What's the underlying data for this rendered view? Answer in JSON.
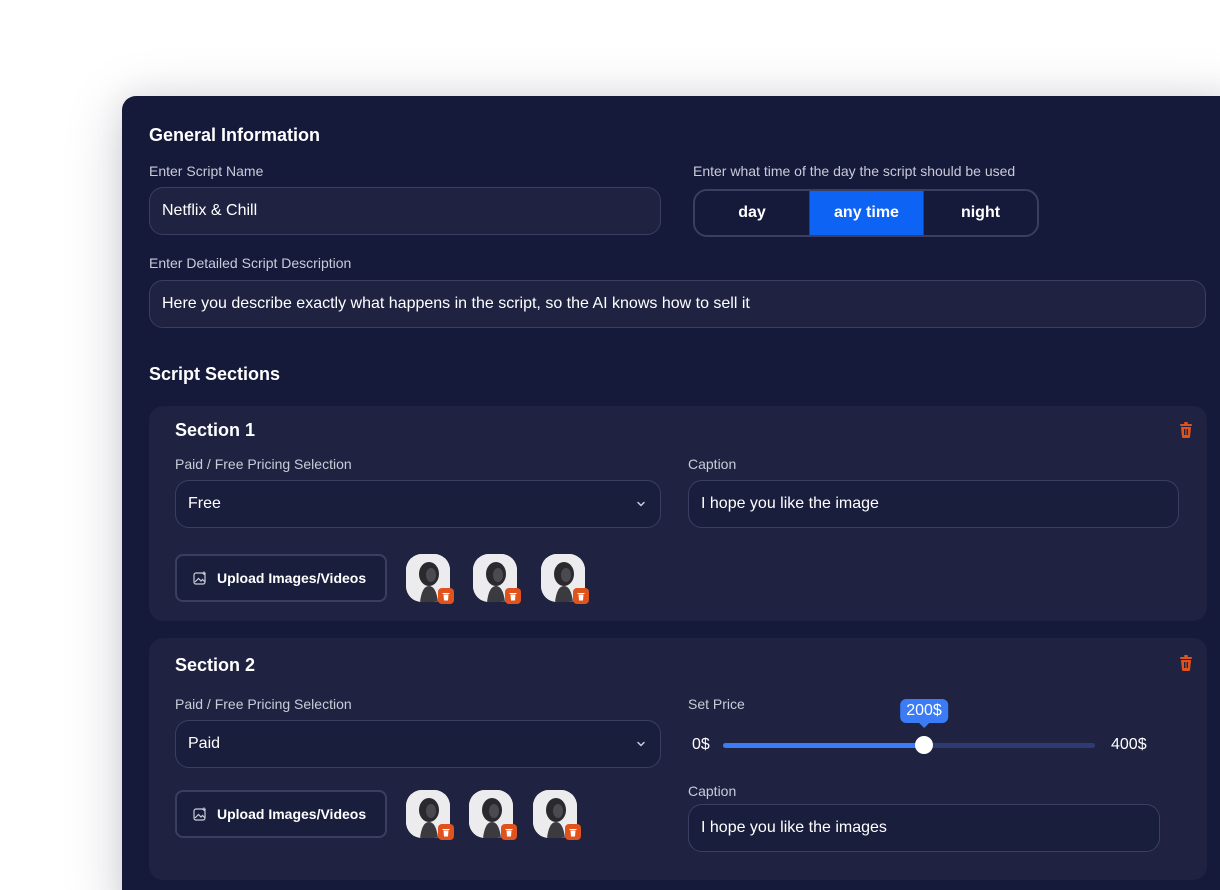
{
  "general": {
    "title": "General Information",
    "script_name_label": "Enter Script Name",
    "script_name_value": "Netflix & Chill",
    "time_label": "Enter what time of the day the script should be used",
    "time_options": [
      "day",
      "any time",
      "night"
    ],
    "time_selected": "any time",
    "description_label": "Enter Detailed Script Description",
    "description_value": "Here you describe exactly what happens in the script, so the AI knows how to sell it"
  },
  "sections_title": "Script Sections",
  "sections": [
    {
      "title": "Section 1",
      "pricing_label": "Paid / Free Pricing Selection",
      "pricing_value": "Free",
      "caption_label": "Caption",
      "caption_value": "I hope you like the image",
      "upload_label": "Upload Images/Videos",
      "thumbnail_count": 3
    },
    {
      "title": "Section 2",
      "pricing_label": "Paid / Free Pricing Selection",
      "pricing_value": "Paid",
      "price_label": "Set Price",
      "price_min": "0$",
      "price_max": "400$",
      "price_value": "200$",
      "price_fraction": 0.54,
      "caption_label": "Caption",
      "caption_value": "I hope you like the images",
      "upload_label": "Upload Images/Videos",
      "thumbnail_count": 3
    }
  ],
  "colors": {
    "panel_bg": "#15193a",
    "card_bg": "#1f2341",
    "accent": "#0c63f4",
    "slider": "#3b7cf6",
    "danger": "#e0531c"
  },
  "icons": {
    "trash": "trash-icon",
    "chevron": "chevron-down-icon",
    "upload": "image-upload-icon"
  }
}
